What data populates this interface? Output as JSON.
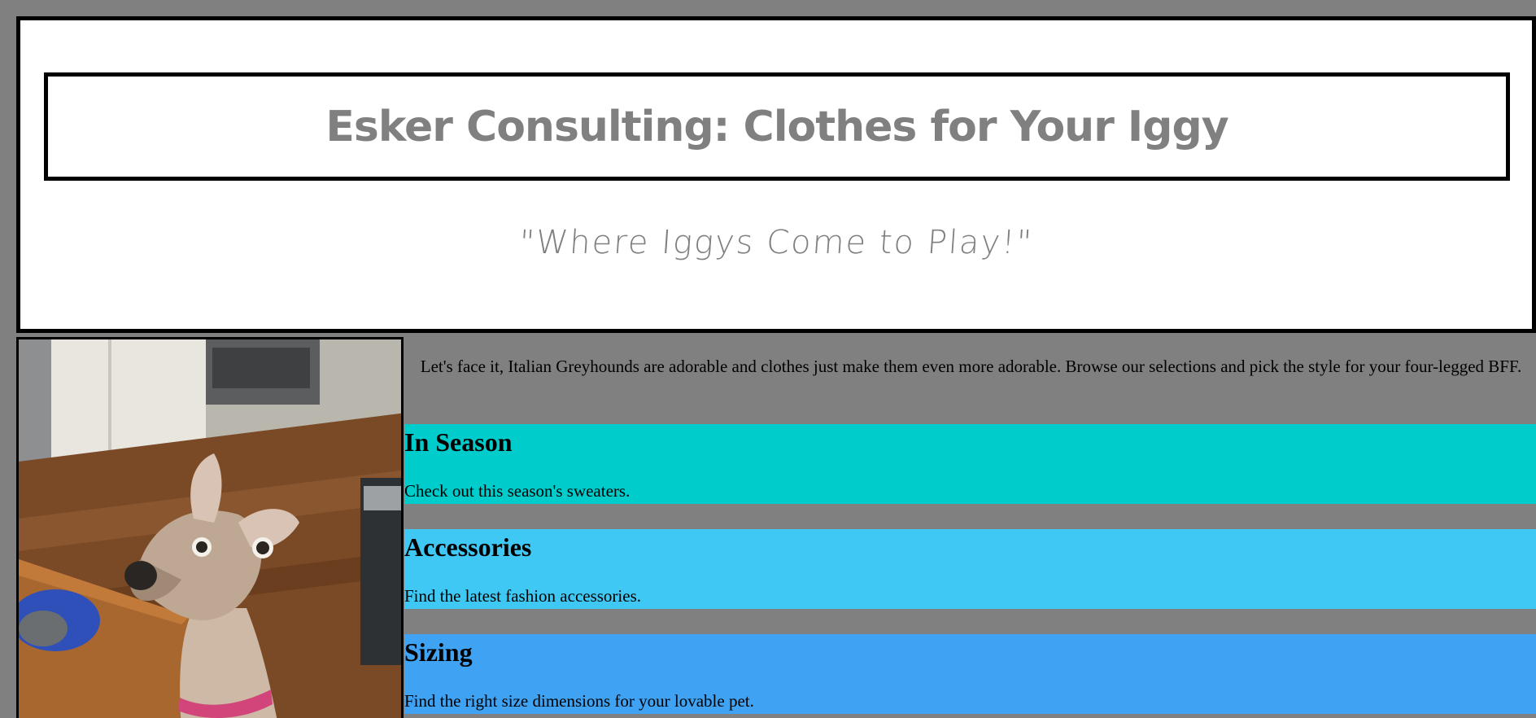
{
  "header": {
    "title": "Esker Consulting: Clothes for Your Iggy",
    "tagline": "\"Where Iggys Come to Play!\""
  },
  "main": {
    "intro": "Let's face it, Italian Greyhounds are adorable and clothes just make them even more adorable. Browse our selections and pick the style for your four-legged BFF.",
    "sections": [
      {
        "title": "In Season",
        "text": "Check out this season's sweaters.",
        "color": "#00cccc"
      },
      {
        "title": "Accessories",
        "text": "Find the latest fashion accessories.",
        "color": "#40c8f4"
      },
      {
        "title": "Sizing",
        "text": "Find the right size dimensions for your lovable pet.",
        "color": "#3fa2f2"
      }
    ]
  },
  "colors": {
    "background": "#808080",
    "title_text": "#808080",
    "header_bg": "#ffffff"
  }
}
